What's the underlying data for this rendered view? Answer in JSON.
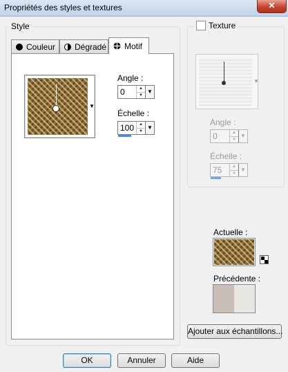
{
  "window": {
    "title": "Propriétés des styles et textures",
    "close_symbol": "✕"
  },
  "style_group": {
    "label": "Style",
    "tabs": [
      {
        "label": "Couleur",
        "icon": "filled-circle-icon"
      },
      {
        "label": "Dégradé",
        "icon": "half-circle-icon"
      },
      {
        "label": "Motif",
        "icon": "pattern-grid-icon"
      }
    ],
    "active_tab": "Motif",
    "angle_label": "Angle :",
    "angle_value": "0",
    "scale_label": "Échelle :",
    "scale_value": "100"
  },
  "texture_group": {
    "label": "Texture",
    "checked": false,
    "angle_label": "Angle :",
    "angle_value": "0",
    "scale_label": "Échelle :",
    "scale_value": "75",
    "enabled": false
  },
  "current": {
    "label": "Actuelle :"
  },
  "previous": {
    "label": "Précédente :"
  },
  "buttons": {
    "add_samples": "Ajouter aux échantillons...",
    "ok": "OK",
    "cancel": "Annuler",
    "help": "Aide"
  },
  "colors": {
    "accent": "#3d8ee8",
    "pattern_brown": "#8a6a34",
    "previous_left": "#c9bfb8",
    "previous_right": "#e8e7e2"
  }
}
